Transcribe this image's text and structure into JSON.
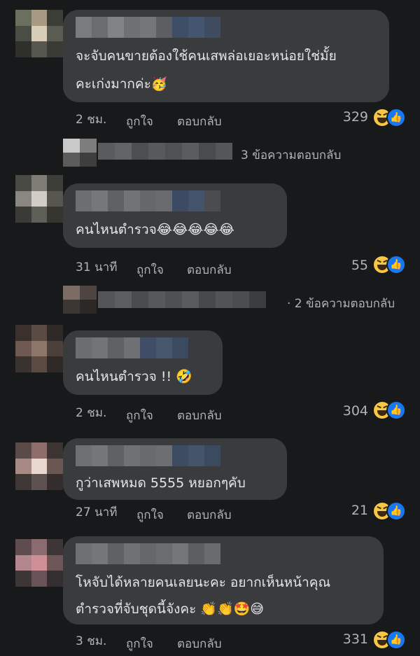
{
  "comments": [
    {
      "lines": [
        "จะจับคนขายต้องใช้คนเสพล่อเยอะหน่อยใช่มั้ย",
        "คะเก่งมากค่ะ🥳"
      ],
      "time": "2 ชม.",
      "like_label": "ถูกใจ",
      "reply_label": "ตอบกลับ",
      "reaction_count": "329",
      "replies_label": "3 ข้อความตอบกลับ"
    },
    {
      "lines": [
        "คนไหนตำรวจ😂😂😂😂😂"
      ],
      "time": "31 นาที",
      "like_label": "ถูกใจ",
      "reply_label": "ตอบกลับ",
      "reaction_count": "55",
      "replies_label": "· 2 ข้อความตอบกลับ"
    },
    {
      "lines": [
        "คนไหนตำรวจ !! 🤣"
      ],
      "time": "2 ชม.",
      "like_label": "ถูกใจ",
      "reply_label": "ตอบกลับ",
      "reaction_count": "304"
    },
    {
      "lines": [
        "กูว่าเสพหมด 5555 หยอกๆคับ"
      ],
      "time": "27 นาที",
      "like_label": "ถูกใจ",
      "reply_label": "ตอบกลับ",
      "reaction_count": "21"
    },
    {
      "lines": [
        "โหจับได้หลายคนเลยนะคะ  อยากเห็นหน้าคุณ",
        "ตำรวจที่จับชุดนี้จังคะ 👏👏🤩😅"
      ],
      "time": "3 ชม.",
      "like_label": "ถูกใจ",
      "reply_label": "ตอบกลับ",
      "reaction_count": "331"
    }
  ],
  "icons": {
    "reaction_haha": "haha-reaction-icon",
    "reaction_like": "like-reaction-icon"
  },
  "colors": {
    "background": "#18191a",
    "bubble": "#3a3b3c",
    "text": "#e4e6eb",
    "secondary_text": "#b0b3b8",
    "like_blue": "#1877f2",
    "haha_yellow": "#f7c744"
  }
}
